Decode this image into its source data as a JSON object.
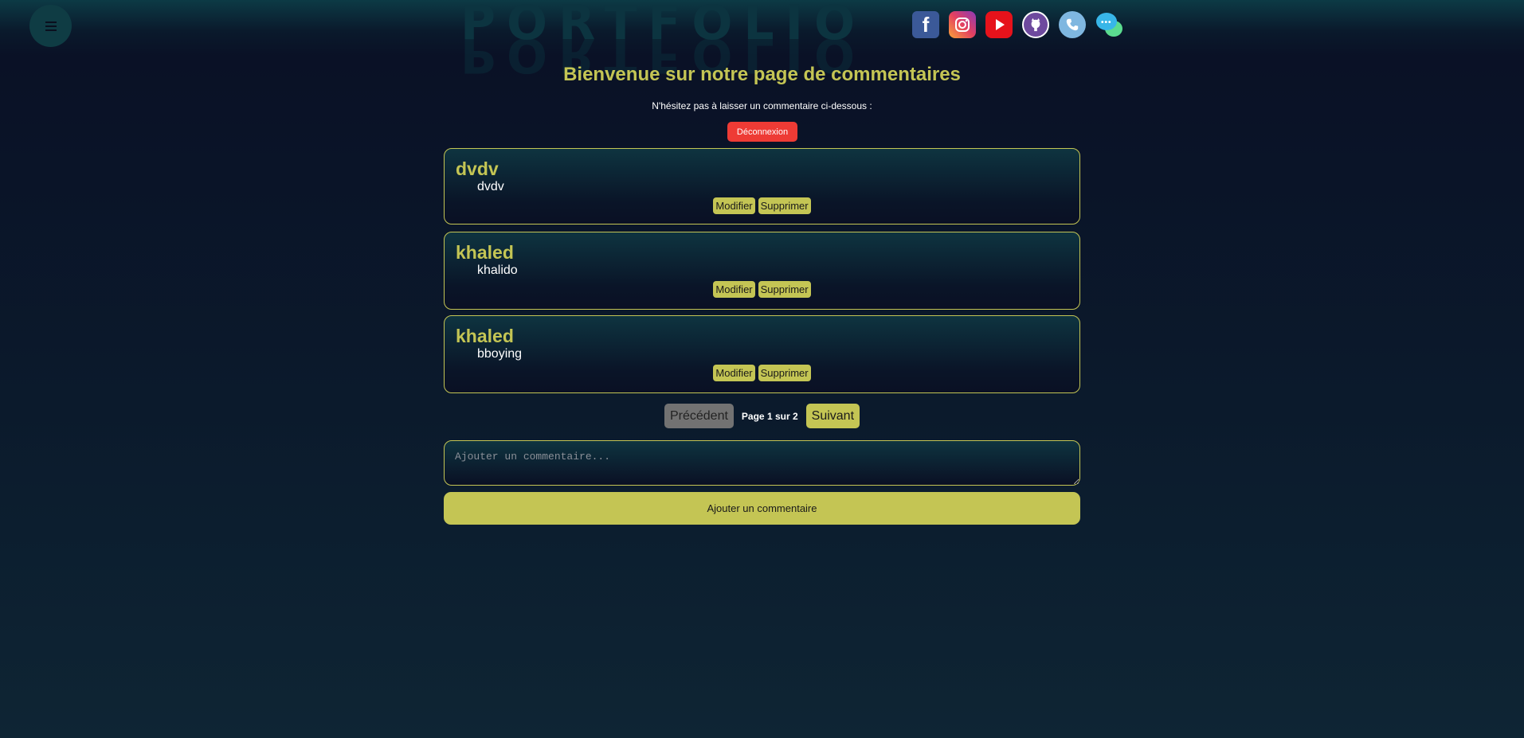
{
  "header": {
    "logo_text": "PORTFOLIO",
    "socials": [
      {
        "name": "facebook-icon",
        "glyph": "f"
      },
      {
        "name": "instagram-icon",
        "glyph": "◎"
      },
      {
        "name": "youtube-icon",
        "glyph": ""
      },
      {
        "name": "github-icon",
        "glyph": "🐱"
      },
      {
        "name": "phone-icon",
        "glyph": "✆"
      },
      {
        "name": "chat-icon",
        "glyph": "•••"
      }
    ]
  },
  "page": {
    "title": "Bienvenue sur notre page de commentaires",
    "subtitle": "N'hésitez pas à laisser un commentaire ci-dessous :",
    "logout_label": "Déconnexion"
  },
  "comments": [
    {
      "author": "dvdv",
      "text": "dvdv",
      "edit_label": "Modifier",
      "delete_label": "Supprimer"
    },
    {
      "author": "khaled",
      "text": "khalido",
      "edit_label": "Modifier",
      "delete_label": "Supprimer"
    },
    {
      "author": "khaled",
      "text": "bboying",
      "edit_label": "Modifier",
      "delete_label": "Supprimer"
    }
  ],
  "pagination": {
    "prev_label": "Précédent",
    "page_label": "Page 1 sur 2",
    "next_label": "Suivant"
  },
  "form": {
    "placeholder": "Ajouter un commentaire...",
    "submit_label": "Ajouter un commentaire"
  },
  "colors": {
    "accent": "#c4c554",
    "danger": "#ee3b35",
    "background": "#0b1a2c"
  }
}
